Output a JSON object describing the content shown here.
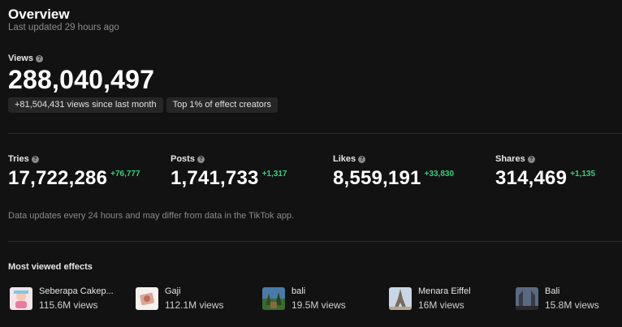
{
  "header": {
    "title": "Overview",
    "last_updated": "Last updated 29 hours ago"
  },
  "views": {
    "label": "Views",
    "value": "288,040,497",
    "chips": [
      "+81,504,431 views since last month",
      "Top 1% of effect creators"
    ]
  },
  "stats": [
    {
      "label": "Tries",
      "value": "17,722,286",
      "delta": "+76,777"
    },
    {
      "label": "Posts",
      "value": "1,741,733",
      "delta": "+1,317"
    },
    {
      "label": "Likes",
      "value": "8,559,191",
      "delta": "+33,830"
    },
    {
      "label": "Shares",
      "value": "314,469",
      "delta": "+1,135"
    }
  ],
  "note": "Data updates every 24 hours and may differ from data in the TikTok app.",
  "most_viewed": {
    "title": "Most viewed effects",
    "items": [
      {
        "name": "Seberapa Cakep...",
        "views": "115.6M views"
      },
      {
        "name": "Gaji",
        "views": "112.1M views"
      },
      {
        "name": "bali",
        "views": "19.5M views"
      },
      {
        "name": "Menara Eiffel",
        "views": "16M views"
      },
      {
        "name": "Bali",
        "views": "15.8M views"
      }
    ]
  },
  "colors": {
    "background": "#121212",
    "positive_delta": "#2fd27c",
    "muted_text": "#8a8a8a",
    "chip_bg": "#262626"
  },
  "icons": {
    "help": "question-circle-icon"
  }
}
